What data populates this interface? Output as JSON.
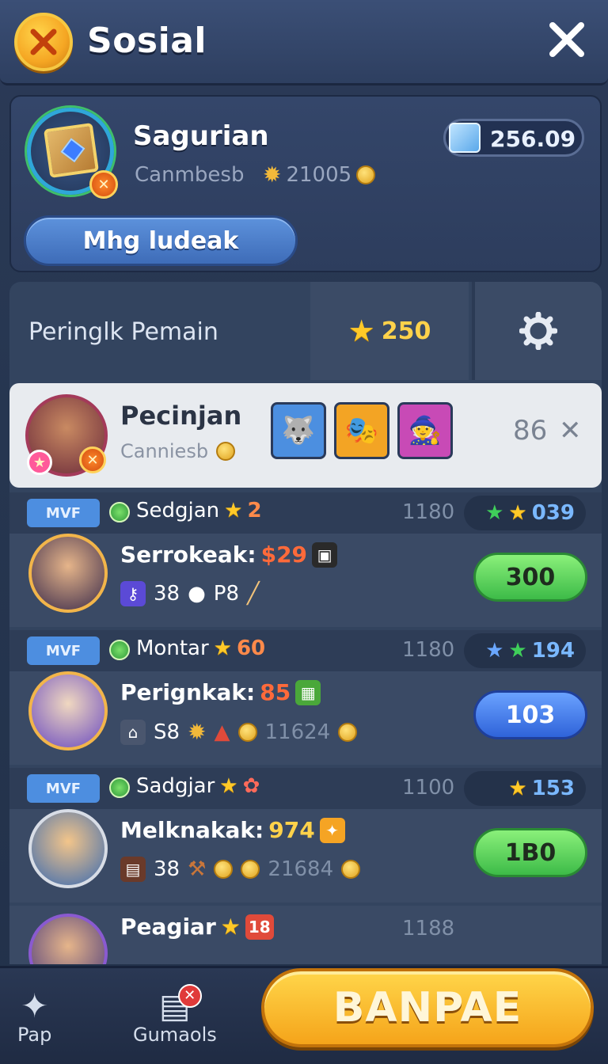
{
  "header": {
    "title": "Sosial"
  },
  "profile": {
    "name": "Sagurian",
    "subtitle": "Canmbesb",
    "coins": "21005",
    "gems": "256.09"
  },
  "primary_button": "Mhg ludeak",
  "leaderboard": {
    "title": "Peringlk Pemain",
    "score": "250",
    "me": {
      "name": "Pecinjan",
      "subtitle": "Canniesb",
      "count": "86"
    },
    "entries": [
      {
        "badge": "MVF",
        "rank_label": "Sedgjan",
        "rank_value": "2",
        "points": "1180",
        "pill_value": "039",
        "title": "Serrokeak:",
        "amount": "$29",
        "stat1": "38",
        "stat2": "P8",
        "button": "300"
      },
      {
        "badge": "MVF",
        "rank_label": "Montar",
        "rank_value": "60",
        "points": "1180",
        "pill_value": "194",
        "title": "Perignkak:",
        "amount": "85",
        "stat1": "S8",
        "stat2": "11624",
        "button": "103"
      },
      {
        "badge": "MVF",
        "rank_label": "Sadgjar",
        "rank_value": "",
        "points": "1100",
        "pill_value": "153",
        "title": "Melknakak:",
        "amount": "974",
        "stat1": "38",
        "stat2": "21684",
        "button": "1B0"
      }
    ],
    "partial": {
      "name": "Peagiar",
      "value": "18",
      "points": "1188"
    }
  },
  "bottom_nav": {
    "item1": "Pap",
    "item2": "Gumaols",
    "cta": "BANPAE"
  }
}
